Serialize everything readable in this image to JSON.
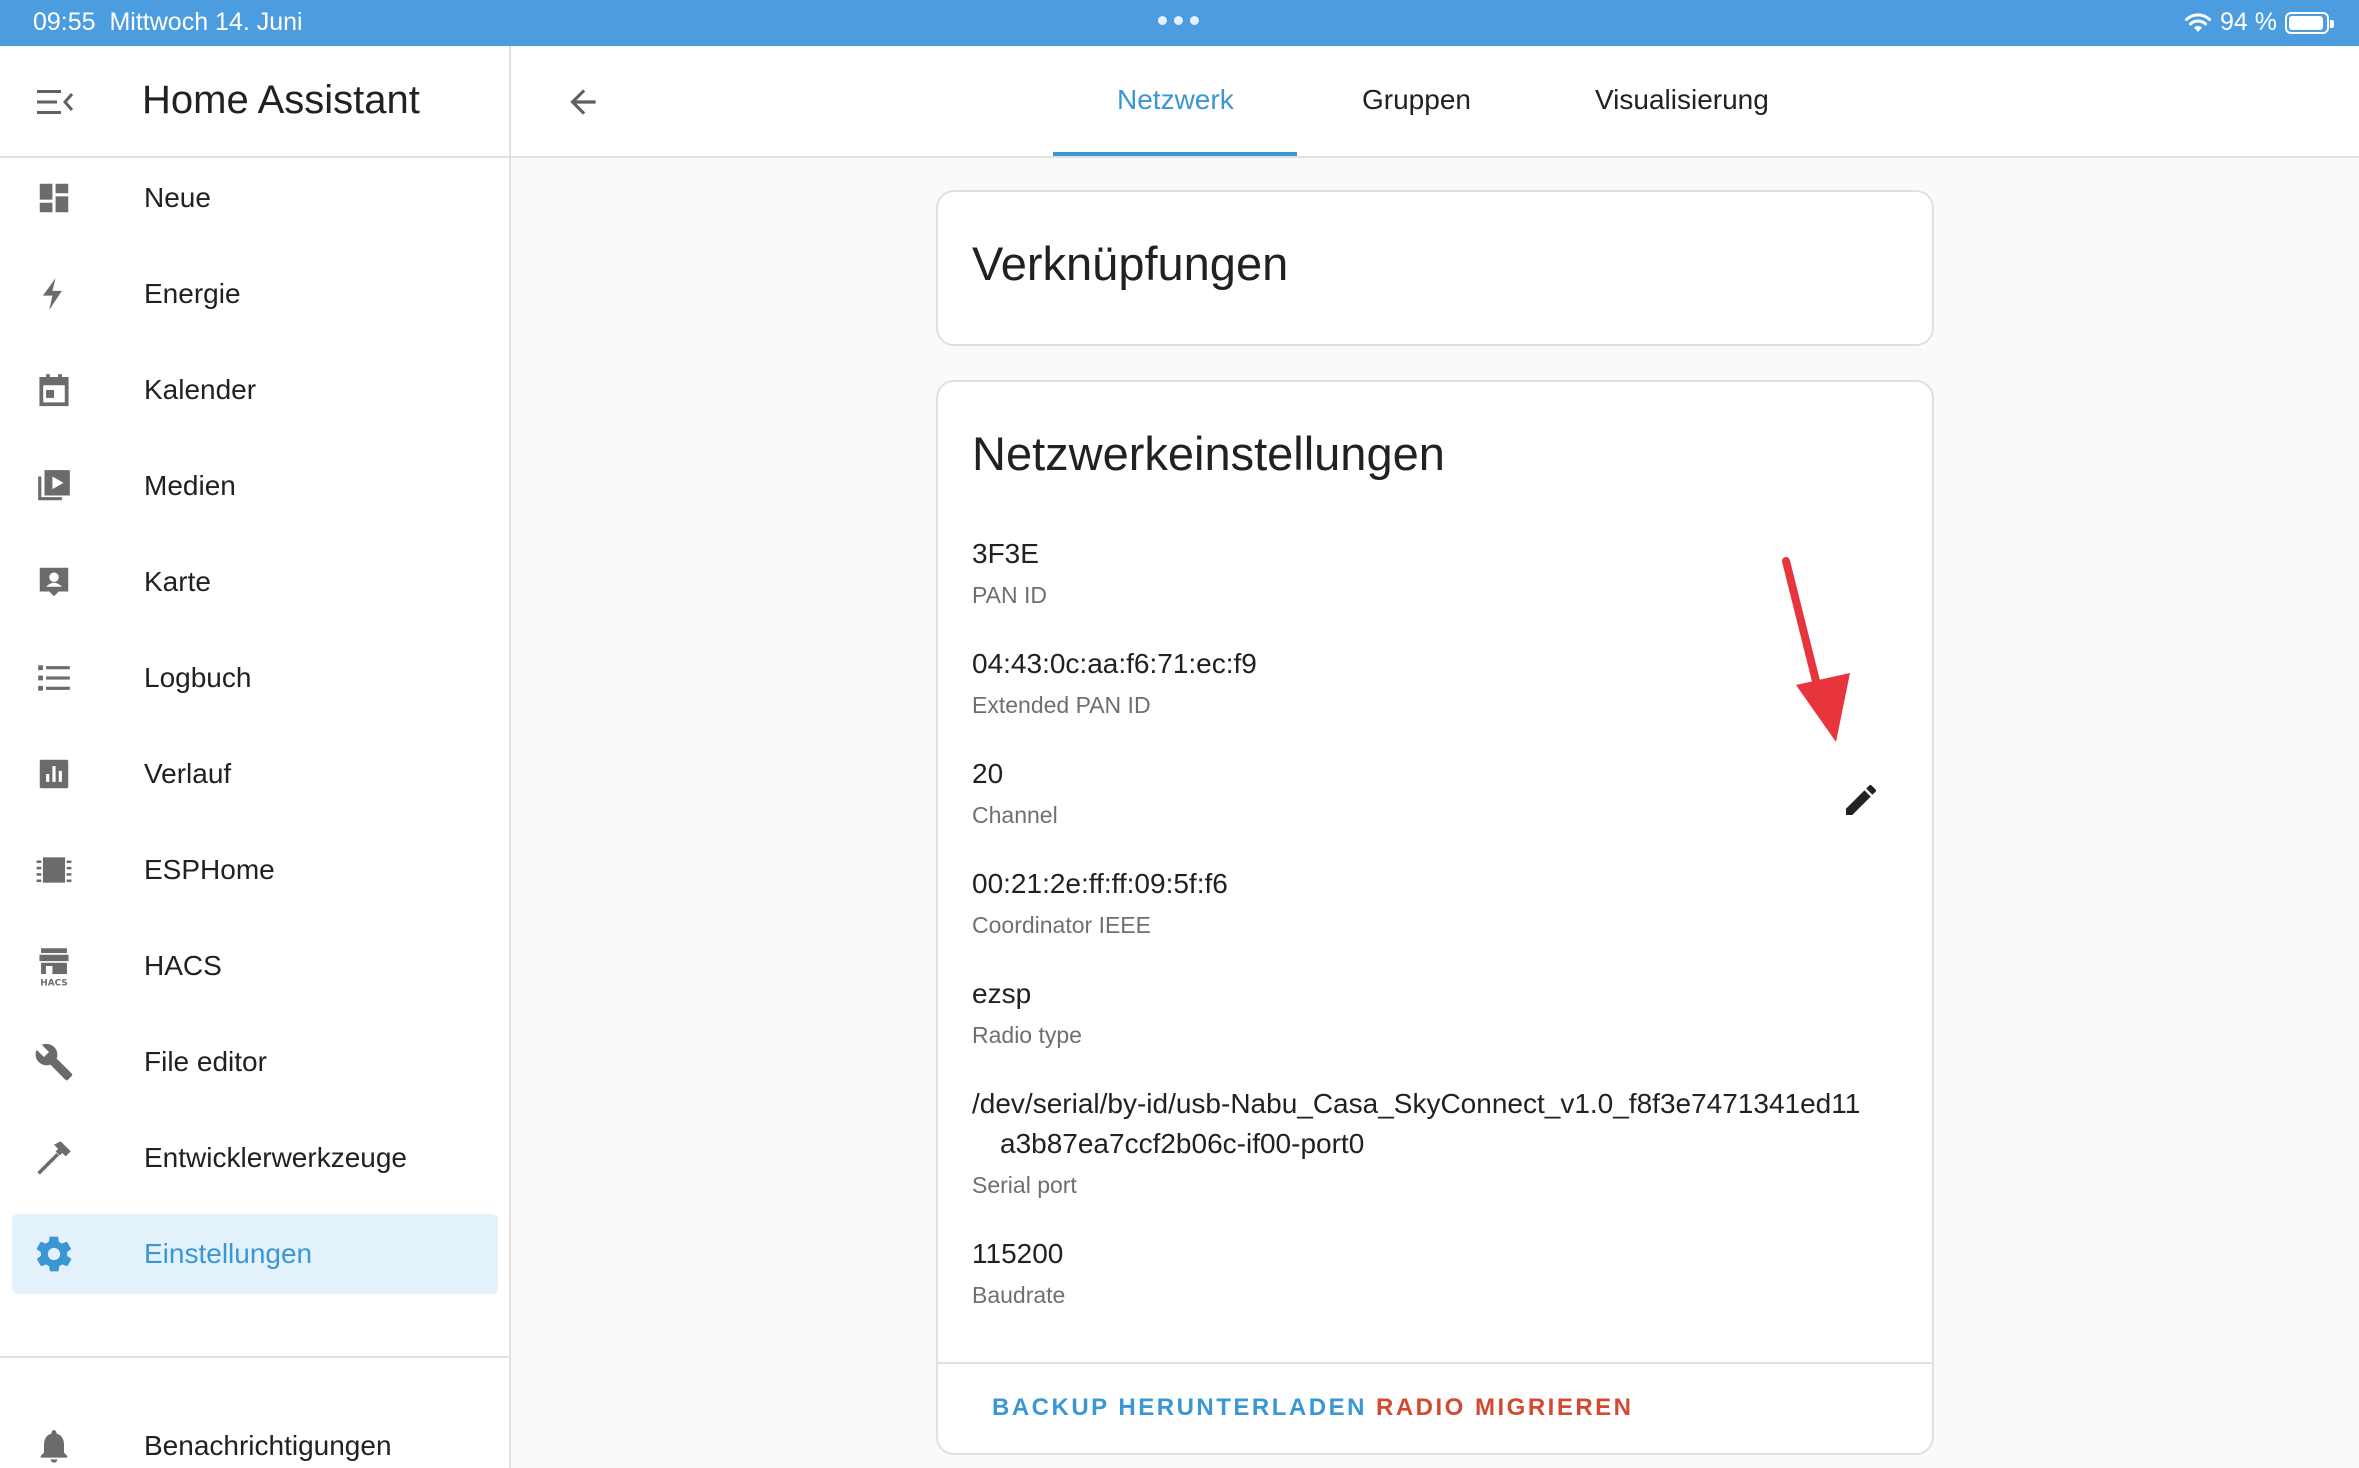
{
  "status_bar": {
    "time": "09:55",
    "date": "Mittwoch 14. Juni",
    "battery": "94 %",
    "battery_level": 0.94
  },
  "sidebar": {
    "title": "Home Assistant",
    "items": [
      {
        "label": "Neue",
        "icon": "dashboard-icon"
      },
      {
        "label": "Energie",
        "icon": "lightning-bolt-icon"
      },
      {
        "label": "Kalender",
        "icon": "calendar-icon"
      },
      {
        "label": "Medien",
        "icon": "media-play-icon"
      },
      {
        "label": "Karte",
        "icon": "map-account-icon"
      },
      {
        "label": "Logbuch",
        "icon": "list-icon"
      },
      {
        "label": "Verlauf",
        "icon": "bar-chart-icon"
      },
      {
        "label": "ESPHome",
        "icon": "chip-icon"
      },
      {
        "label": "HACS",
        "icon": "hacs-store-icon"
      },
      {
        "label": "File editor",
        "icon": "wrench-icon"
      },
      {
        "label": "Entwicklerwerkzeuge",
        "icon": "hammer-icon"
      },
      {
        "label": "Einstellungen",
        "icon": "gear-icon"
      }
    ],
    "notifications": {
      "label": "Benachrichtigungen",
      "icon": "bell-icon"
    },
    "hacs_badge": "HACS"
  },
  "tabs": [
    {
      "label": "Netzwerk",
      "active": true
    },
    {
      "label": "Gruppen",
      "active": false
    },
    {
      "label": "Visualisierung",
      "active": false
    }
  ],
  "shortcuts_card": {
    "title": "Verknüpfungen"
  },
  "network_card": {
    "title": "Netzwerkeinstellungen",
    "fields": [
      {
        "value": "3F3E",
        "key": "PAN ID"
      },
      {
        "value": "04:43:0c:aa:f6:71:ec:f9",
        "key": "Extended PAN ID"
      },
      {
        "value": "20",
        "key": "Channel"
      },
      {
        "value": "00:21:2e:ff:ff:09:5f:f6",
        "key": "Coordinator IEEE"
      },
      {
        "value": "ezsp",
        "key": "Radio type"
      },
      {
        "value": "/dev/serial/by-id/usb-Nabu_Casa_SkyConnect_v1.0_f8f3e7471341ed11",
        "value_cont": "a3b87ea7ccf2b06c-if00-port0",
        "key": "Serial port"
      },
      {
        "value": "115200",
        "key": "Baudrate"
      }
    ],
    "actions": {
      "backup": "BACKUP HERUNTERLADEN",
      "migrate": "RADIO MIGRIEREN"
    }
  },
  "colors": {
    "accent": "#3a97d4",
    "danger": "#d14b33",
    "annotation_arrow": "#e8353d",
    "status_bar": "#4c9de0"
  }
}
